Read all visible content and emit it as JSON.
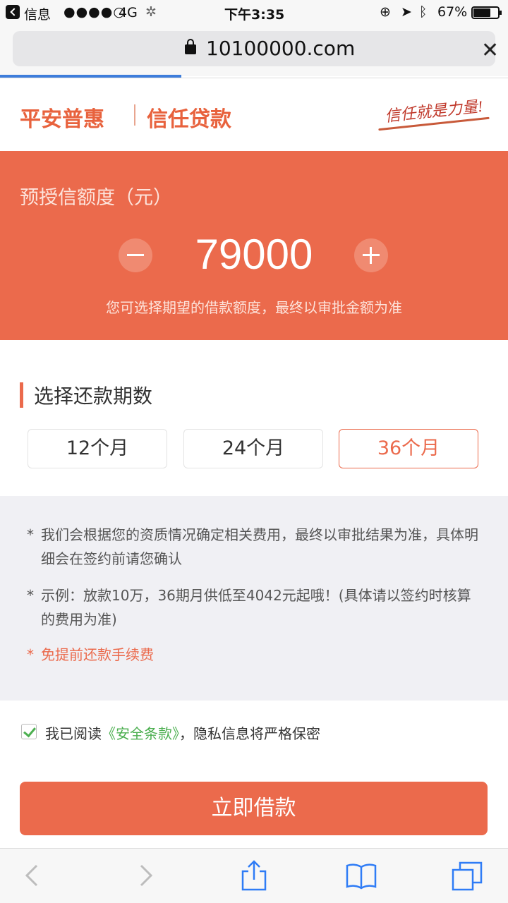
{
  "status_bar": {
    "app": "信息",
    "signal": "●●●●○",
    "network": "4G",
    "time": "下午3:35",
    "battery": "67%"
  },
  "browser": {
    "url": "10100000.com"
  },
  "header": {
    "brand": "平安普惠",
    "product": "信任贷款",
    "slogan": "信任就是力量!"
  },
  "credit": {
    "title": "预授信额度（元）",
    "amount": "79000",
    "hint": "您可选择期望的借款额度，最终以审批金额为准"
  },
  "terms": {
    "heading": "选择还款期数",
    "options": [
      "12个月",
      "24个月",
      "36个月"
    ],
    "selected": "36个月"
  },
  "notes": {
    "star": "*",
    "note1": "我们会根据您的资质情况确定相关费用，最终以审批结果为准，具体明细会在签约前请您确认",
    "note2": "示例：放款10万，36期月供低至4042元起哦！(具体请以签约时核算的费用为准)",
    "note3": "免提前还款手续费"
  },
  "agreement": {
    "prefix": "我已阅读",
    "link": "《安全条款》",
    "suffix": "，隐私信息将严格保密",
    "checked": true
  },
  "action": {
    "loan_button": "立即借款"
  },
  "colors": {
    "accent": "#eb6a4c",
    "link": "#4caf50",
    "progress": "#3d7ddb"
  }
}
